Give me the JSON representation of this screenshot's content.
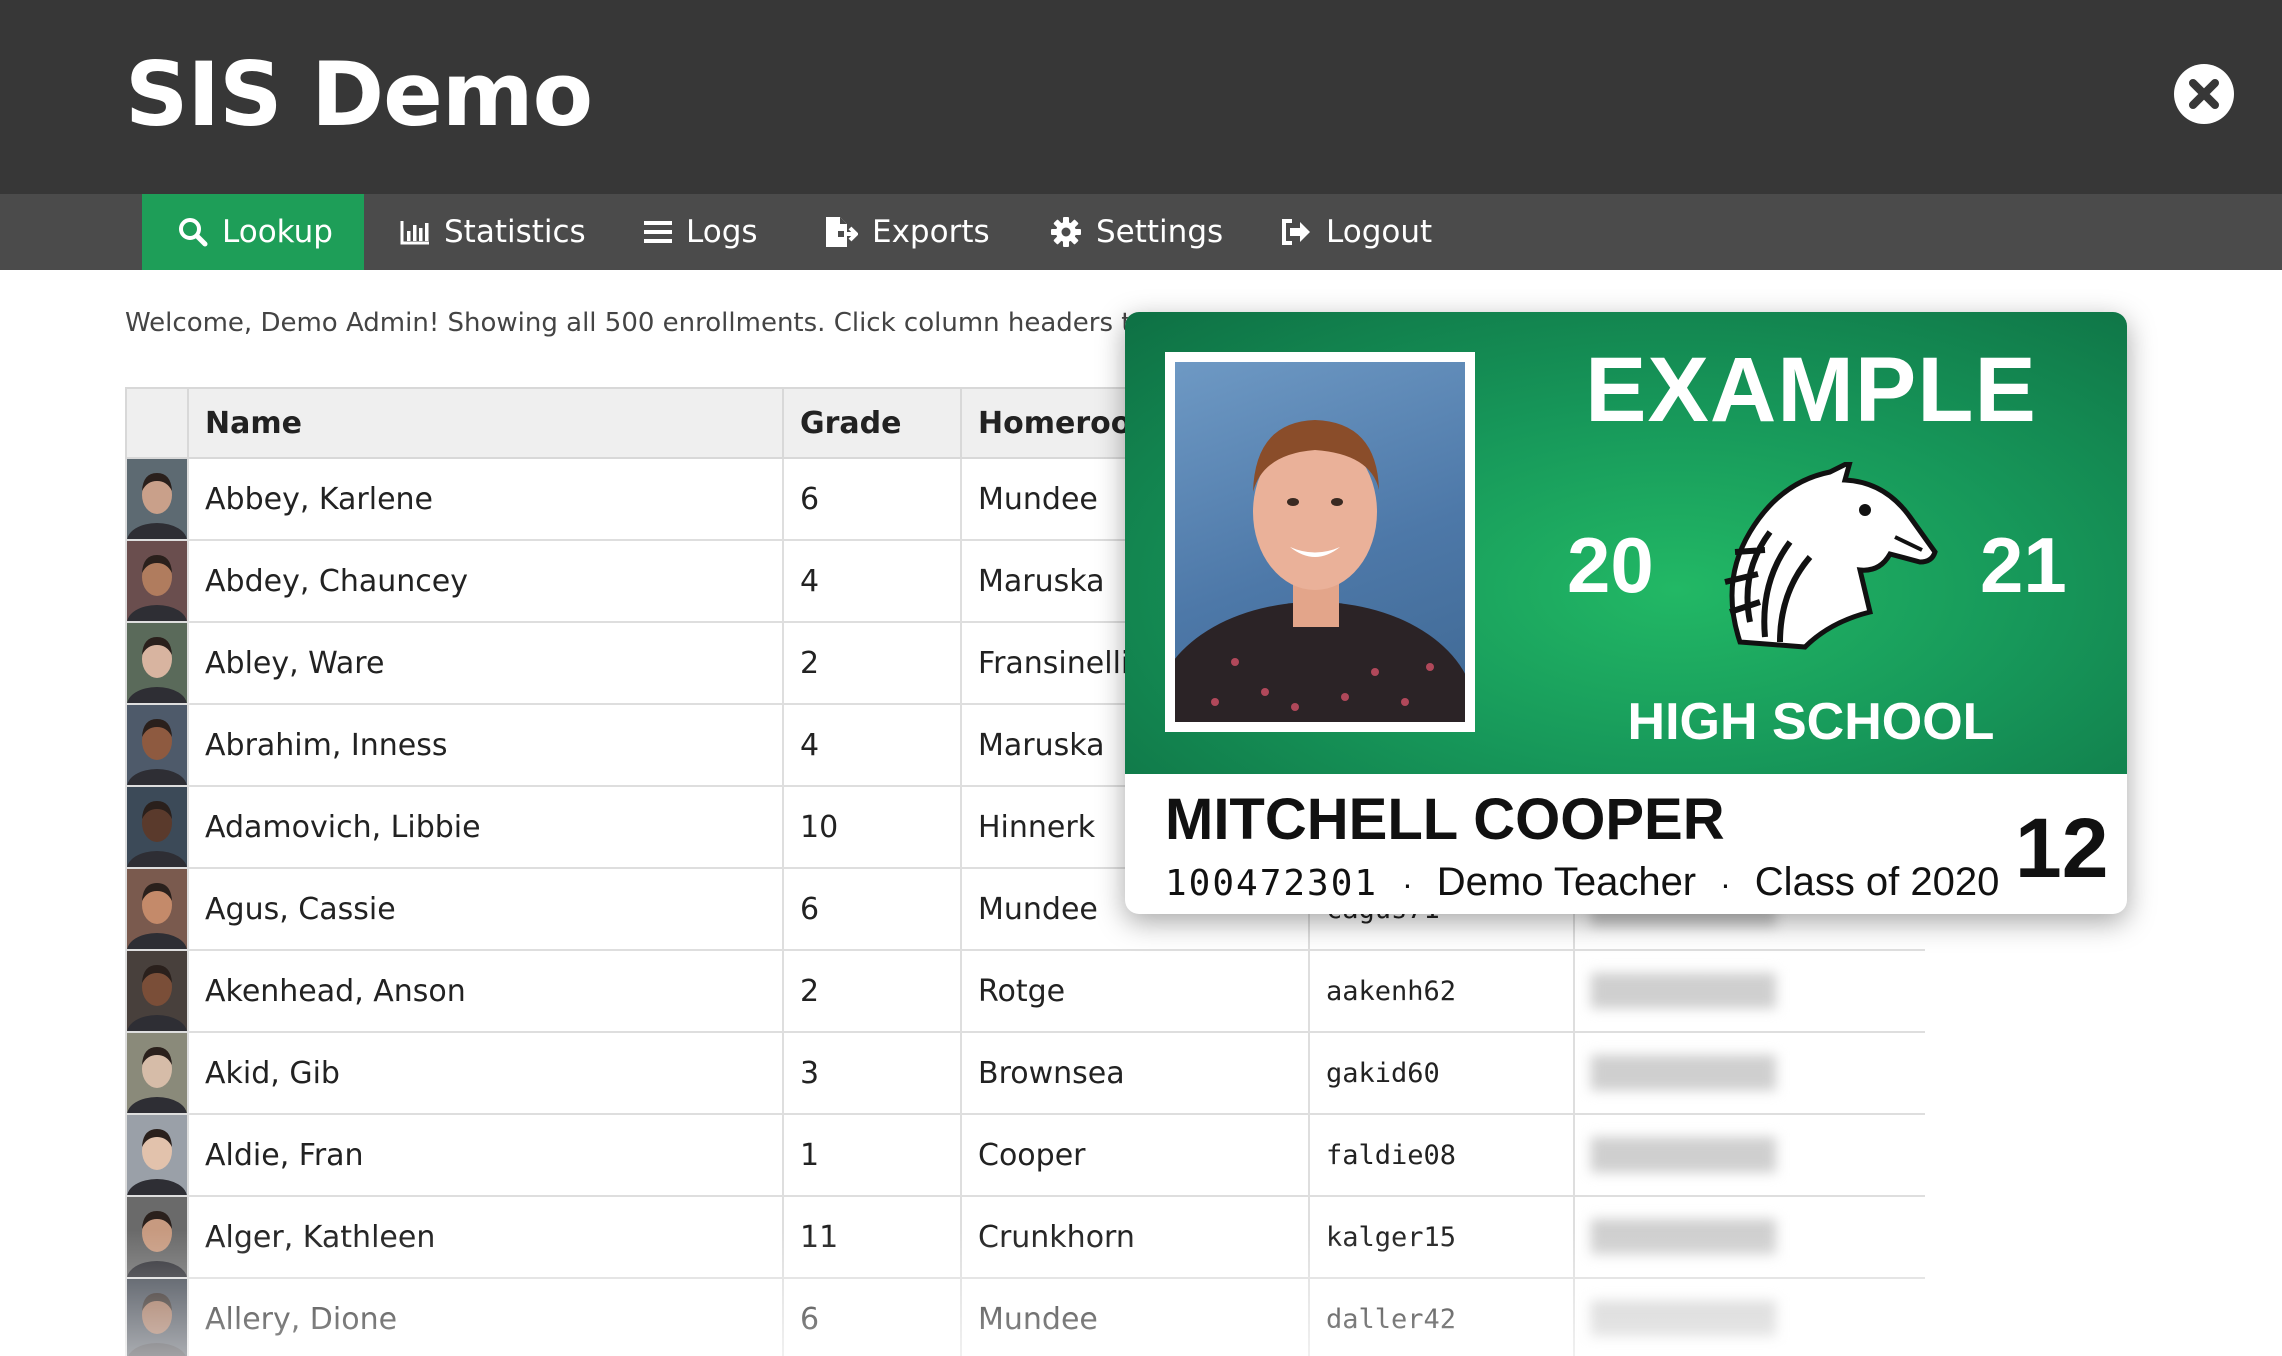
{
  "app": {
    "title": "SIS Demo"
  },
  "nav": [
    {
      "label": "Lookup",
      "icon": "search-icon",
      "active": true
    },
    {
      "label": "Statistics",
      "icon": "bar-chart-icon",
      "active": false
    },
    {
      "label": "Logs",
      "icon": "list-icon",
      "active": false
    },
    {
      "label": "Exports",
      "icon": "file-export-icon",
      "active": false
    },
    {
      "label": "Settings",
      "icon": "gear-icon",
      "active": false
    },
    {
      "label": "Logout",
      "icon": "sign-out-icon",
      "active": false
    }
  ],
  "welcome_text": "Welcome, Demo Admin! Showing all 500 enrollments. Click column headers to",
  "table": {
    "columns": [
      "",
      "Name",
      "Grade",
      "Homeroom"
    ],
    "rows": [
      {
        "name": "Abbey, Karlene",
        "grade": "6",
        "homeroom": "Mundee",
        "username": ""
      },
      {
        "name": "Abdey, Chauncey",
        "grade": "4",
        "homeroom": "Maruska",
        "username": ""
      },
      {
        "name": "Abley, Ware",
        "grade": "2",
        "homeroom": "Fransinelli",
        "username": ""
      },
      {
        "name": "Abrahim, Inness",
        "grade": "4",
        "homeroom": "Maruska",
        "username": ""
      },
      {
        "name": "Adamovich, Libbie",
        "grade": "10",
        "homeroom": "Hinnerk",
        "username": ""
      },
      {
        "name": "Agus, Cassie",
        "grade": "6",
        "homeroom": "Mundee",
        "username": "cagus71"
      },
      {
        "name": "Akenhead, Anson",
        "grade": "2",
        "homeroom": "Rotge",
        "username": "aakenh62"
      },
      {
        "name": "Akid, Gib",
        "grade": "3",
        "homeroom": "Brownsea",
        "username": "gakid60"
      },
      {
        "name": "Aldie, Fran",
        "grade": "1",
        "homeroom": "Cooper",
        "username": "faldie08"
      },
      {
        "name": "Alger, Kathleen",
        "grade": "11",
        "homeroom": "Crunkhorn",
        "username": "kalger15"
      },
      {
        "name": "Allery, Dione",
        "grade": "6",
        "homeroom": "Mundee",
        "username": "daller42"
      }
    ]
  },
  "id_card": {
    "school_top": "EXAMPLE",
    "year_left": "20",
    "year_right": "21",
    "school_bottom": "HIGH SCHOOL",
    "student_name": "MITCHELL COOPER",
    "student_id": "100472301",
    "separator": "·",
    "teacher": "Demo Teacher",
    "class_of": "Class of 2020",
    "grade": "12",
    "colors": {
      "card_green": "#17985a",
      "header_bg": "#373737",
      "nav_bg": "#4b4b4b",
      "active_nav": "#1e9e58"
    }
  }
}
